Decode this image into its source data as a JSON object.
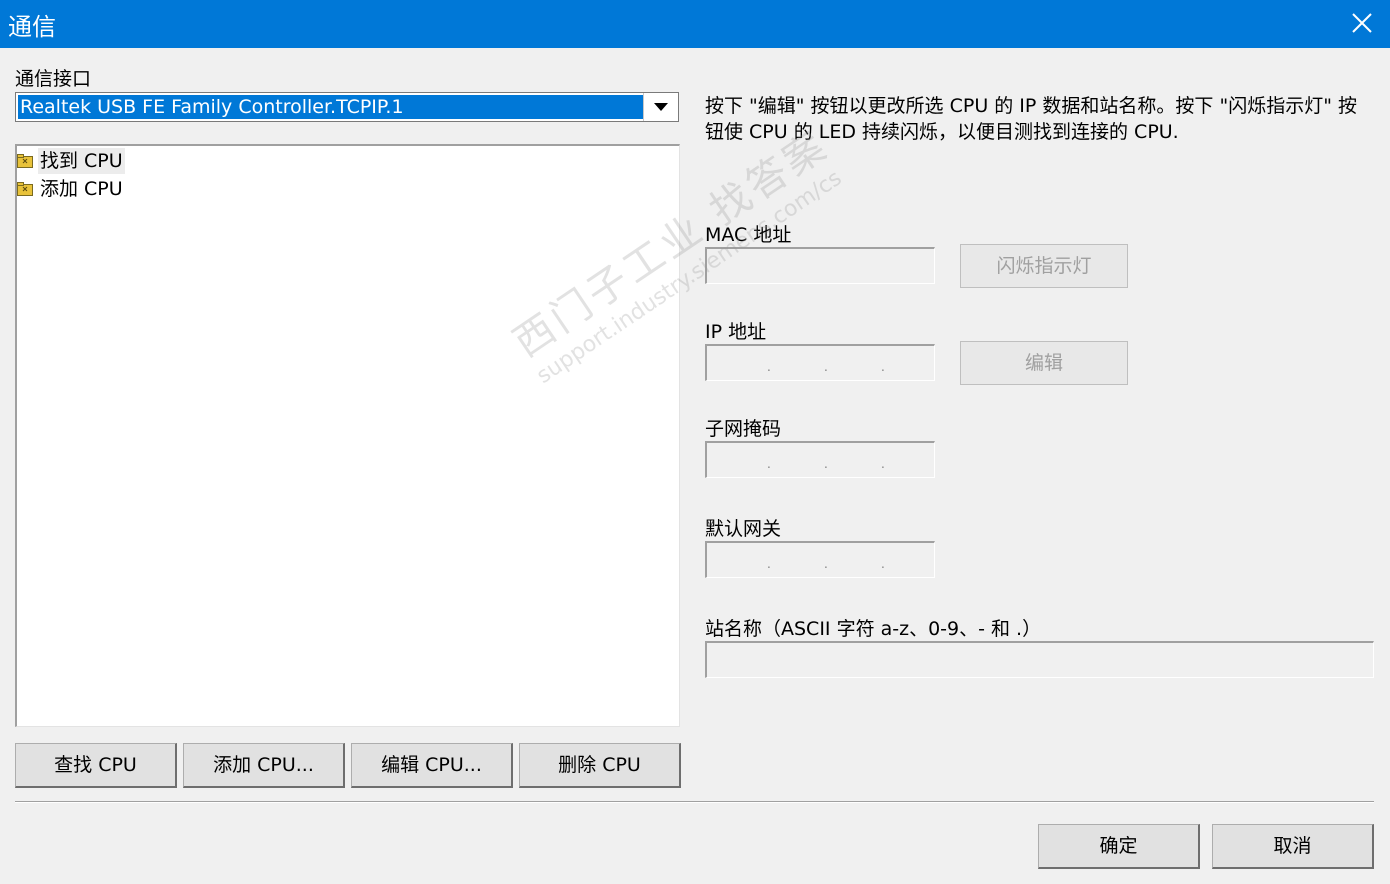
{
  "window": {
    "title": "通信"
  },
  "interface": {
    "label": "通信接口",
    "selected": "Realtek USB FE Family Controller.TCPIP.1"
  },
  "tree": {
    "items": [
      {
        "label": "找到 CPU"
      },
      {
        "label": "添加 CPU"
      }
    ]
  },
  "description": "按下 \"编辑\" 按钮以更改所选 CPU 的 IP 数据和站名称。按下 \"闪烁指示灯\" 按钮使 CPU 的 LED 持续闪烁，以便目测找到连接的 CPU.",
  "fields": {
    "mac_label": "MAC 地址",
    "mac_value": "",
    "ip_label": "IP 地址",
    "subnet_label": "子网掩码",
    "gateway_label": "默认网关",
    "station_label": "站名称（ASCII 字符 a-z、0-9、- 和 .）",
    "station_value": ""
  },
  "buttons": {
    "flash": "闪烁指示灯",
    "edit": "编辑",
    "find_cpu": "查找 CPU",
    "add_cpu": "添加 CPU...",
    "edit_cpu": "编辑 CPU...",
    "delete_cpu": "删除 CPU",
    "ok": "确定",
    "cancel": "取消"
  },
  "watermark": {
    "line1": "西门子工业 找答案",
    "line2": "support.industry.siemens.com/cs"
  },
  "icons": {
    "tree_folder": "folder-icon",
    "close": "close-icon",
    "dropdown": "chevron-down-icon"
  },
  "colors": {
    "titlebar": "#0078d7",
    "selection": "#0078d7",
    "background": "#f0f0f0"
  }
}
